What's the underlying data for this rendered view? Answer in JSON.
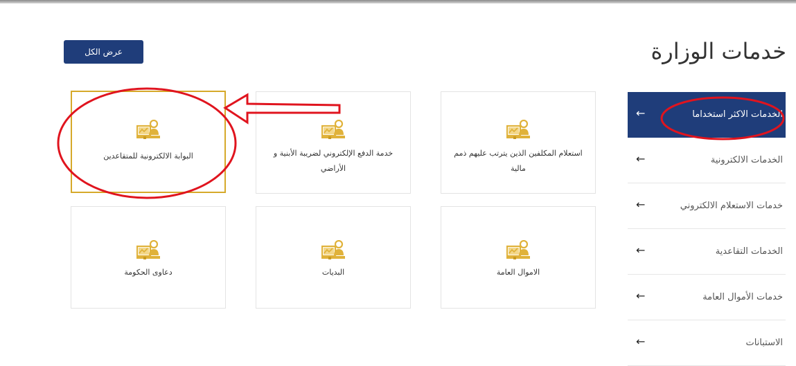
{
  "header": {
    "title": "خدمات الوزارة",
    "view_all_label": "عرض الكل"
  },
  "sidebar": {
    "items": [
      {
        "label": "الخدمات الاكثر استخداما",
        "active": true
      },
      {
        "label": "الخدمات الالكترونية",
        "active": false
      },
      {
        "label": "خدمات الاستعلام الالكتروني",
        "active": false
      },
      {
        "label": "الخدمات التقاعدية",
        "active": false
      },
      {
        "label": "خدمات الأموال العامة",
        "active": false
      },
      {
        "label": "الاستبانات",
        "active": false
      }
    ]
  },
  "cards": [
    {
      "label": "استعلام المكلفين الذين يترتب عليهم ذمم مالية",
      "icon": "office-worker-icon"
    },
    {
      "label": "خدمة الدفع الإلكتروني لضريبة الأبنية و الأراضي",
      "icon": "office-worker-icon"
    },
    {
      "label": "البوابة الالكترونية للمتقاعدين",
      "icon": "office-worker-icon",
      "highlighted": true
    },
    {
      "label": "الاموال العامة",
      "icon": "office-worker-icon"
    },
    {
      "label": "البديات",
      "icon": "office-worker-icon"
    },
    {
      "label": "دعاوى الحكومة",
      "icon": "office-worker-icon"
    }
  ],
  "colors": {
    "primary": "#1f3d7a",
    "highlight_border": "#d6a92a",
    "icon": "#e0b23a",
    "annotation": "#e0141e"
  }
}
